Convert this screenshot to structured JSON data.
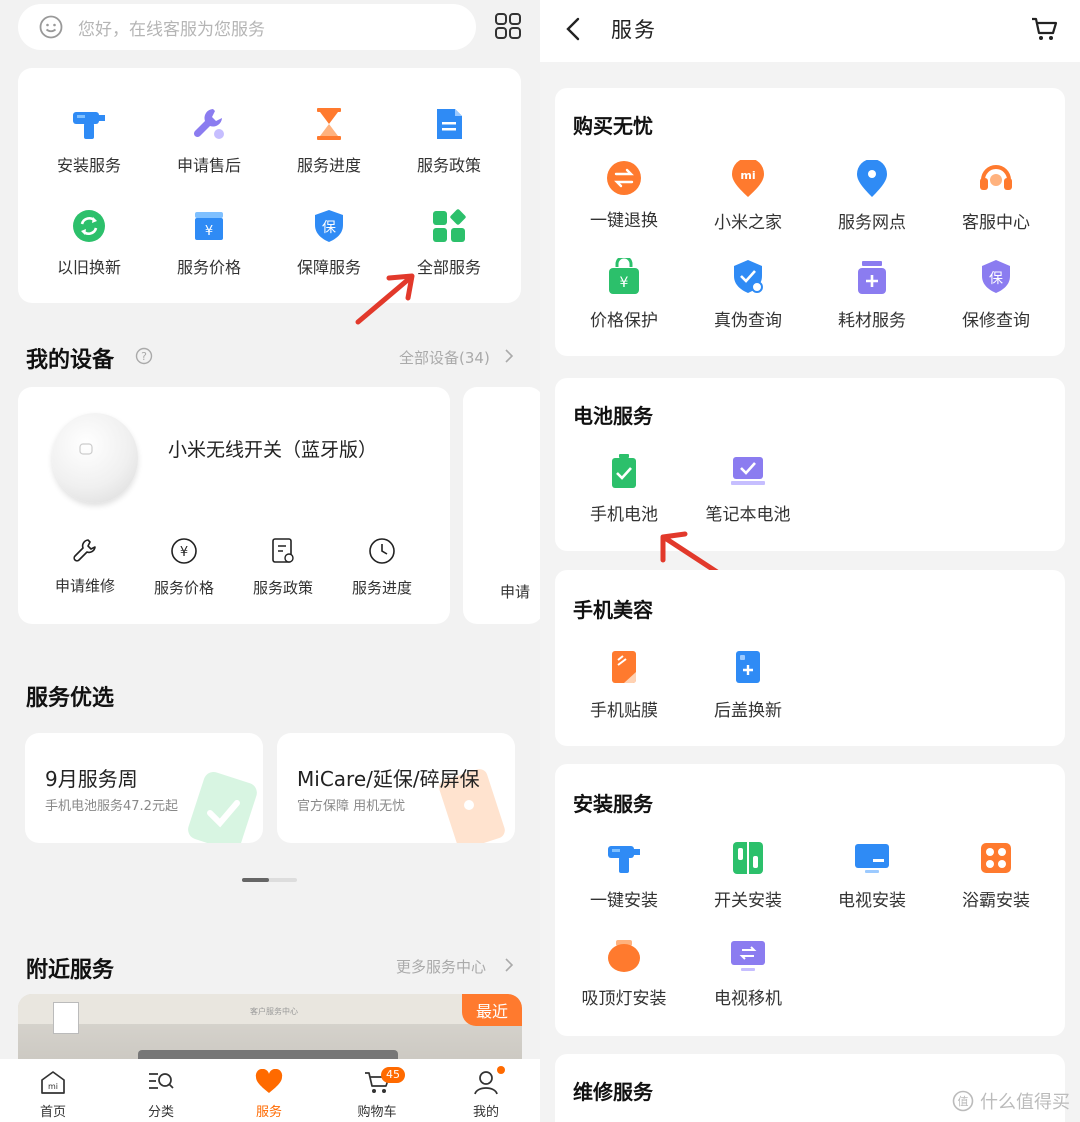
{
  "left": {
    "search": {
      "placeholder": "您好，在线客服为您服务"
    },
    "quick_services": [
      {
        "label": "安装服务",
        "icon": "drill-icon"
      },
      {
        "label": "申请售后",
        "icon": "wrench-icon"
      },
      {
        "label": "服务进度",
        "icon": "hourglass-icon"
      },
      {
        "label": "服务政策",
        "icon": "document-icon"
      },
      {
        "label": "以旧换新",
        "icon": "refresh-icon"
      },
      {
        "label": "服务价格",
        "icon": "price-box-icon"
      },
      {
        "label": "保障服务",
        "icon": "shield-icon"
      },
      {
        "label": "全部服务",
        "icon": "apps-icon"
      }
    ],
    "my_devices": {
      "title": "我的设备",
      "link": "全部设备(34)",
      "device_name": "小米无线开关（蓝牙版）",
      "actions": [
        "申请维修",
        "服务价格",
        "服务政策",
        "服务进度"
      ],
      "peek_action": "申请"
    },
    "featured": {
      "title": "服务优选",
      "promos": [
        {
          "title": "9月服务周",
          "subtitle": "手机电池服务47.2元起"
        },
        {
          "title": "MiCare/延保/碎屏保",
          "subtitle": "官方保障 用机无忧"
        }
      ]
    },
    "nearby": {
      "title": "附近服务",
      "link": "更多服务中心",
      "badge": "最近",
      "sign": "客户服务中心"
    },
    "tabs": [
      {
        "label": "首页",
        "icon": "home-icon"
      },
      {
        "label": "分类",
        "icon": "category-icon"
      },
      {
        "label": "服务",
        "icon": "heart-icon"
      },
      {
        "label": "购物车",
        "icon": "cart-icon",
        "badge": "45"
      },
      {
        "label": "我的",
        "icon": "profile-icon"
      }
    ]
  },
  "right": {
    "title": "服务",
    "sections": [
      {
        "title": "购买无忧",
        "items": [
          {
            "label": "一键退换",
            "icon": "exchange-icon"
          },
          {
            "label": "小米之家",
            "icon": "mi-store-icon"
          },
          {
            "label": "服务网点",
            "icon": "location-pin-icon"
          },
          {
            "label": "客服中心",
            "icon": "headset-icon"
          },
          {
            "label": "价格保护",
            "icon": "price-protect-icon"
          },
          {
            "label": "真伪查询",
            "icon": "verify-icon"
          },
          {
            "label": "耗材服务",
            "icon": "consumables-icon"
          },
          {
            "label": "保修查询",
            "icon": "warranty-icon"
          }
        ]
      },
      {
        "title": "电池服务",
        "items": [
          {
            "label": "手机电池",
            "icon": "phone-battery-icon"
          },
          {
            "label": "笔记本电池",
            "icon": "laptop-battery-icon"
          }
        ]
      },
      {
        "title": "手机美容",
        "items": [
          {
            "label": "手机贴膜",
            "icon": "screen-film-icon"
          },
          {
            "label": "后盖换新",
            "icon": "back-cover-icon"
          }
        ]
      },
      {
        "title": "安装服务",
        "items": [
          {
            "label": "一键安装",
            "icon": "drill-icon"
          },
          {
            "label": "开关安装",
            "icon": "switch-icon"
          },
          {
            "label": "电视安装",
            "icon": "tv-icon"
          },
          {
            "label": "浴霸安装",
            "icon": "bath-heater-icon"
          },
          {
            "label": "吸顶灯安装",
            "icon": "ceiling-lamp-icon"
          },
          {
            "label": "电视移机",
            "icon": "tv-move-icon"
          }
        ]
      },
      {
        "title": "维修服务",
        "items": []
      }
    ],
    "watermark": "什么值得买"
  },
  "colors": {
    "orange": "#ff6a00",
    "blue": "#2f8bf5",
    "green": "#2cc06b",
    "purple": "#8b7cf0",
    "annotation_red": "#e2392b"
  }
}
